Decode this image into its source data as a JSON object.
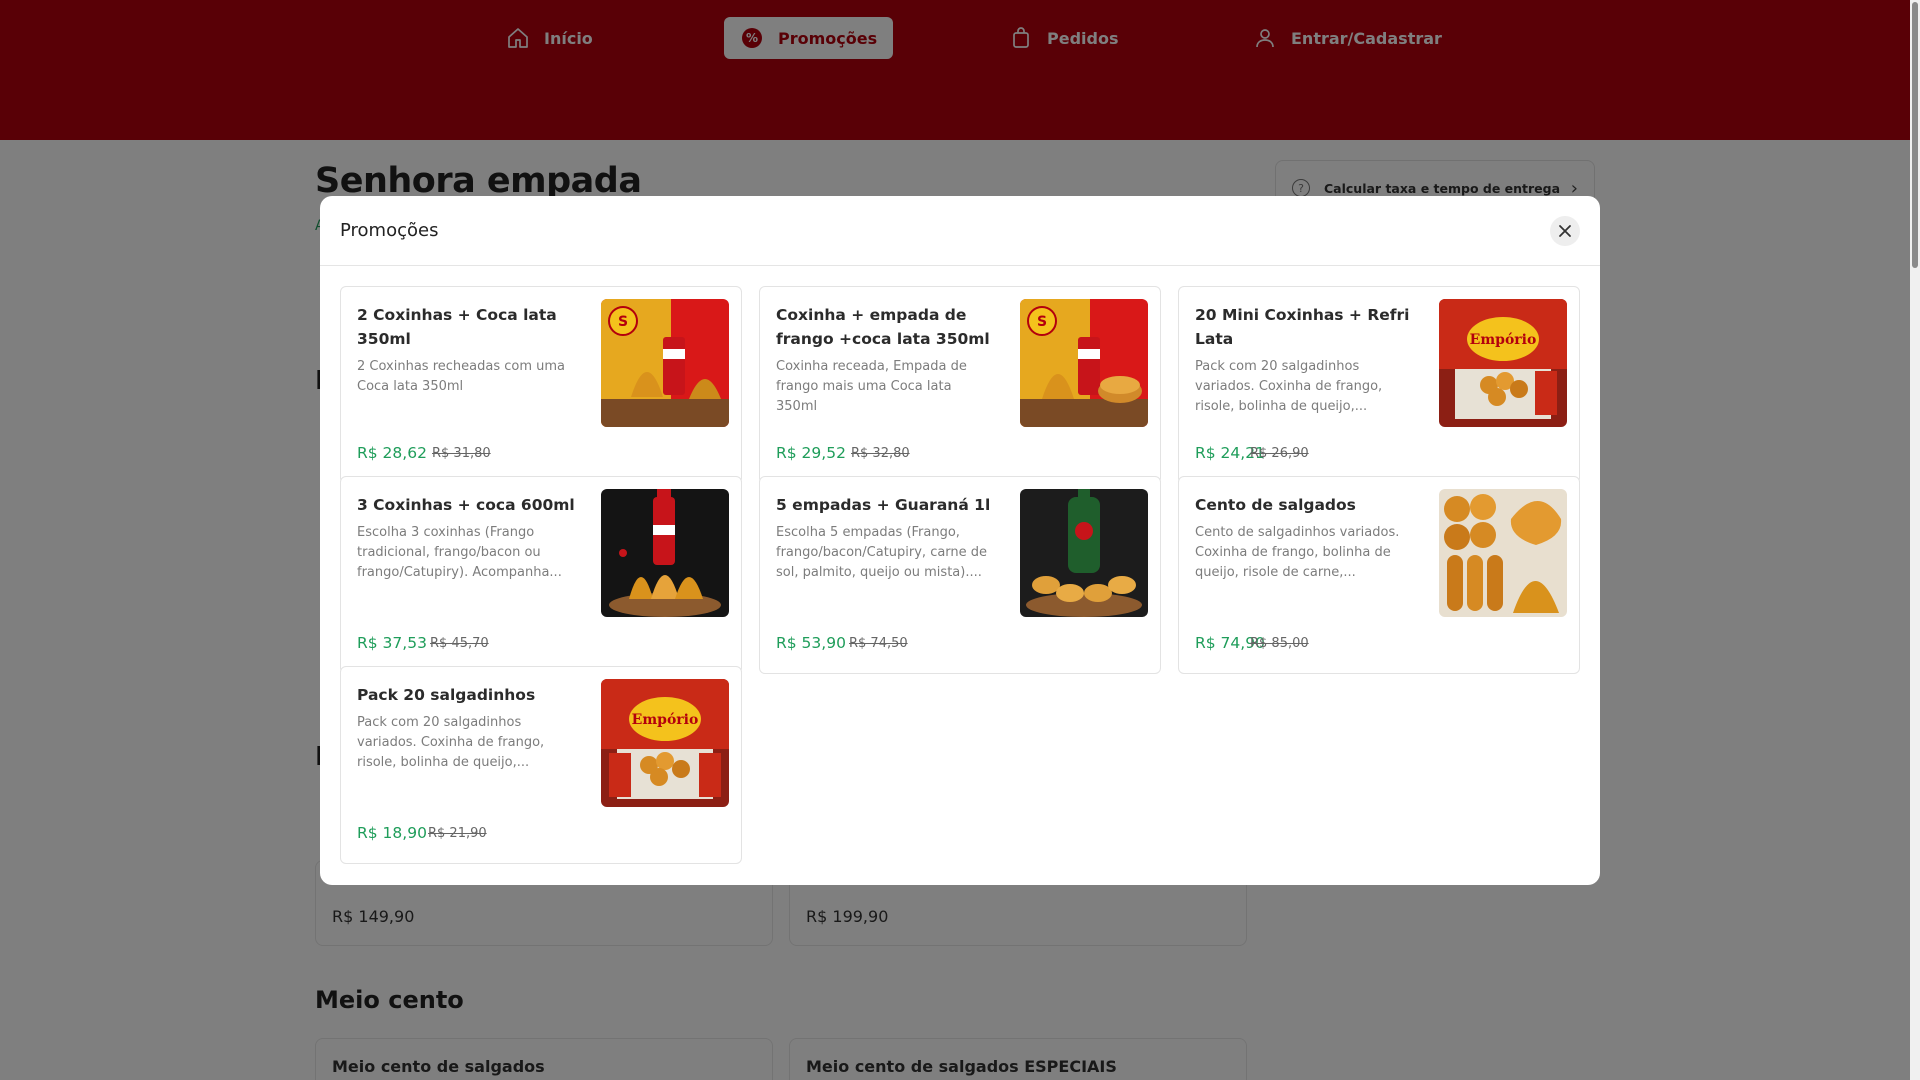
{
  "nav": {
    "items": [
      {
        "label": "Início",
        "icon": "home-icon"
      },
      {
        "label": "Promoções",
        "icon": "promo-badge-icon",
        "active": true
      },
      {
        "label": "Pedidos",
        "icon": "shopping-bag-icon"
      },
      {
        "label": "Entrar/Cadastrar",
        "icon": "user-icon"
      }
    ]
  },
  "page": {
    "title": "Senhora empada",
    "sub": "A",
    "delivery_label": "Calcular taxa e tempo de entrega",
    "letter_1": "I",
    "letter_2": "I",
    "card_price_1": "R$ 149,90",
    "card_price_2": "R$ 199,90",
    "section_meio_cento": "Meio cento",
    "card_title_1": "Meio cento de salgados",
    "card_title_2": "Meio cento de salgados ESPECIAIS"
  },
  "modal": {
    "title": "Promoções",
    "promos": [
      {
        "title": "2 Coxinhas + Coca lata 350ml",
        "desc": "2 Coxinhas recheadas com uma Coca lata 350ml",
        "price": "R$ 28,62",
        "old_price": "R$ 31,80"
      },
      {
        "title": "Coxinha + empada de frango +coca lata 350ml",
        "desc": "Coxinha receada, Empada de frango mais uma Coca lata 350ml",
        "price": "R$ 29,52",
        "old_price": "R$ 32,80"
      },
      {
        "title": "20 Mini Coxinhas + Refri Lata",
        "desc": "Pack com 20 salgadinhos variados. Coxinha de frango, risole, bolinha de queijo,...",
        "price": "R$ 24,21",
        "old_price": "R$ 26,90"
      },
      {
        "title": "3 Coxinhas + coca 600ml",
        "desc": "Escolha 3 coxinhas (Frango tradicional, frango/bacon ou frango/Catupiry). Acompanha...",
        "price": "R$ 37,53",
        "old_price": "R$ 45,70"
      },
      {
        "title": "5 empadas + Guaraná 1l",
        "desc": "Escolha 5 empadas (Frango, frango/bacon/Catupiry, carne de sol, palmito, queijo ou mista)....",
        "price": "R$ 53,90",
        "old_price": "R$ 74,50"
      },
      {
        "title": "Cento de salgados",
        "desc": "Cento de salgadinhos variados. Coxinha de frango, bolinha de queijo, risole de carne,...",
        "price": "R$ 74,90",
        "old_price": "R$ 85,00"
      },
      {
        "title": "Pack 20 salgadinhos",
        "desc": "Pack com 20 salgadinhos variados. Coxinha de frango, risole, bolinha de queijo,...",
        "price": "R$ 18,90",
        "old_price": "R$ 21,90"
      }
    ]
  },
  "colors": {
    "brand_red": "#b3000d",
    "price_green": "#1f9d5a"
  }
}
